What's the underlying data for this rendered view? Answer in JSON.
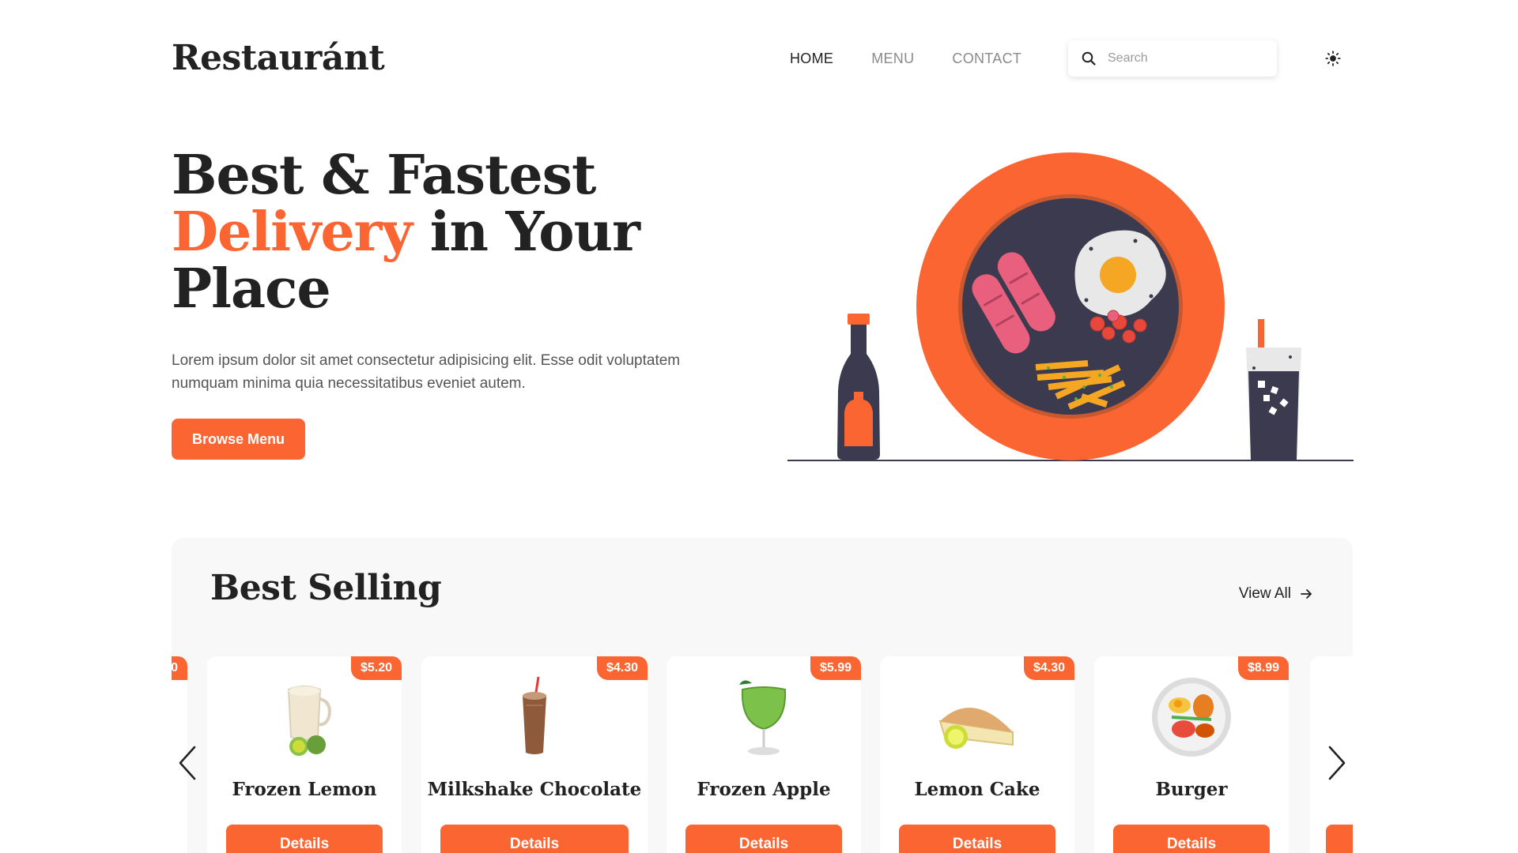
{
  "brand": {
    "logo_text": "Restauránt",
    "accent_color": "#fb6532",
    "dark_color": "#3b3a4f"
  },
  "nav": {
    "items": [
      {
        "label": "HOME",
        "active": true
      },
      {
        "label": "MENU",
        "active": false
      },
      {
        "label": "CONTACT",
        "active": false
      }
    ]
  },
  "search": {
    "placeholder": "Search",
    "value": "",
    "icon": "search-icon"
  },
  "theme_toggle": {
    "icon": "sun-icon"
  },
  "hero": {
    "title_line1": "Best & Fastest",
    "title_accent": "Delivery",
    "title_line2_rest": " in Your",
    "title_line3": "Place",
    "description": "Lorem ipsum dolor sit amet consectetur adipisicing elit. Esse odit voluptatem numquam minima quia necessitatibus eveniet autem.",
    "cta_label": "Browse Menu"
  },
  "best_selling": {
    "title": "Best Selling",
    "view_all_label": "View All",
    "partial_left_price": "0",
    "items": [
      {
        "name": "Frozen Lemon",
        "price": "$5.20",
        "button": "Details",
        "icon": "frozen-lemon-icon"
      },
      {
        "name": "Milkshake Chocolate",
        "price": "$4.30",
        "button": "Details",
        "icon": "milkshake-icon"
      },
      {
        "name": "Frozen Apple",
        "price": "$5.99",
        "button": "Details",
        "icon": "frozen-apple-icon"
      },
      {
        "name": "Lemon Cake",
        "price": "$4.30",
        "button": "Details",
        "icon": "lemon-cake-icon"
      },
      {
        "name": "Burger",
        "price": "$8.99",
        "button": "Details",
        "icon": "burger-plate-icon"
      }
    ],
    "prev_icon": "chevron-left-icon",
    "next_icon": "chevron-right-icon"
  }
}
